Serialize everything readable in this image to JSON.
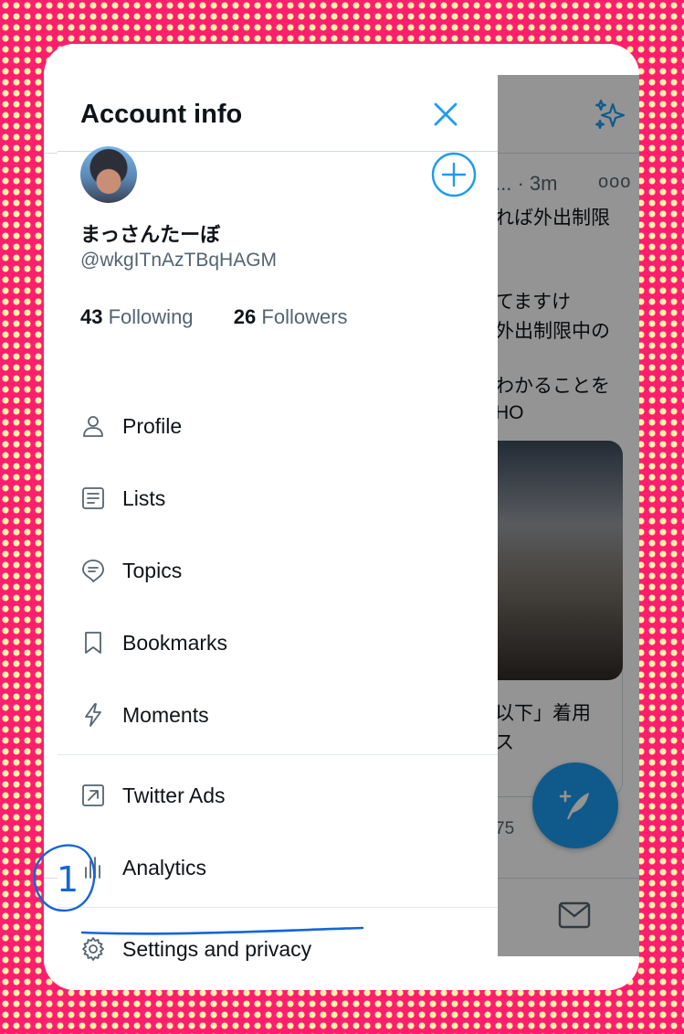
{
  "colors": {
    "accent": "#1d9bf0",
    "text": "#0f1419",
    "muted": "#536471",
    "annotation": "#1565d8"
  },
  "drawer": {
    "title": "Account info",
    "user": {
      "name": "まっさんたーぼ",
      "handle": "@wkgITnAzTBqHAGM"
    },
    "following": {
      "count": "43",
      "label": "Following"
    },
    "followers": {
      "count": "26",
      "label": "Followers"
    },
    "menu": [
      {
        "label": "Profile",
        "icon": "person-icon"
      },
      {
        "label": "Lists",
        "icon": "list-icon"
      },
      {
        "label": "Topics",
        "icon": "topics-icon"
      },
      {
        "label": "Bookmarks",
        "icon": "bookmark-icon"
      },
      {
        "label": "Moments",
        "icon": "lightning-icon"
      },
      {
        "label": "Twitter Ads",
        "icon": "external-arrow-icon"
      },
      {
        "label": "Analytics",
        "icon": "bar-chart-icon"
      },
      {
        "label": "Settings and privacy",
        "icon": "gear-icon"
      }
    ]
  },
  "timeline": {
    "tweet_meta": "... · 3m",
    "more": "ooo",
    "lines": [
      "れば外出制限",
      "てますけ",
      "外出制限中の",
      "わかることを",
      "HO"
    ],
    "card_lines": [
      "以下」着用",
      "ス"
    ],
    "count": "75"
  },
  "annotation": {
    "number": "1"
  }
}
